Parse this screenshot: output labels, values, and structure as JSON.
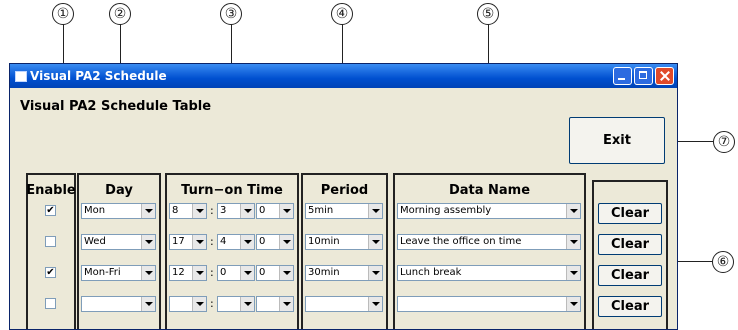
{
  "callouts": [
    "①",
    "②",
    "③",
    "④",
    "⑤",
    "⑥",
    "⑦"
  ],
  "window": {
    "title": "Visual PA2 Schedule",
    "heading": "Visual PA2 Schedule Table"
  },
  "exit_label": "Exit",
  "columns": {
    "enable": "Enable",
    "day": "Day",
    "time": "Turn−on Time",
    "period": "Period",
    "data": "Data Name"
  },
  "rows": [
    {
      "enabled": "✔",
      "day": "Mon",
      "hour": "8",
      "min": "3",
      "sec": "0",
      "period": "5min",
      "data": "Morning assembly",
      "clear": "Clear"
    },
    {
      "enabled": "",
      "day": "Wed",
      "hour": "17",
      "min": "4",
      "sec": "0",
      "period": "10min",
      "data": "Leave the office on time",
      "clear": "Clear"
    },
    {
      "enabled": "✔",
      "day": "Mon-Fri",
      "hour": "12",
      "min": "0",
      "sec": "0",
      "period": "30min",
      "data": "Lunch break",
      "clear": "Clear"
    },
    {
      "enabled": "",
      "day": "",
      "hour": "",
      "min": "",
      "sec": "",
      "period": "",
      "data": "",
      "clear": "Clear"
    }
  ],
  "colon": ":"
}
